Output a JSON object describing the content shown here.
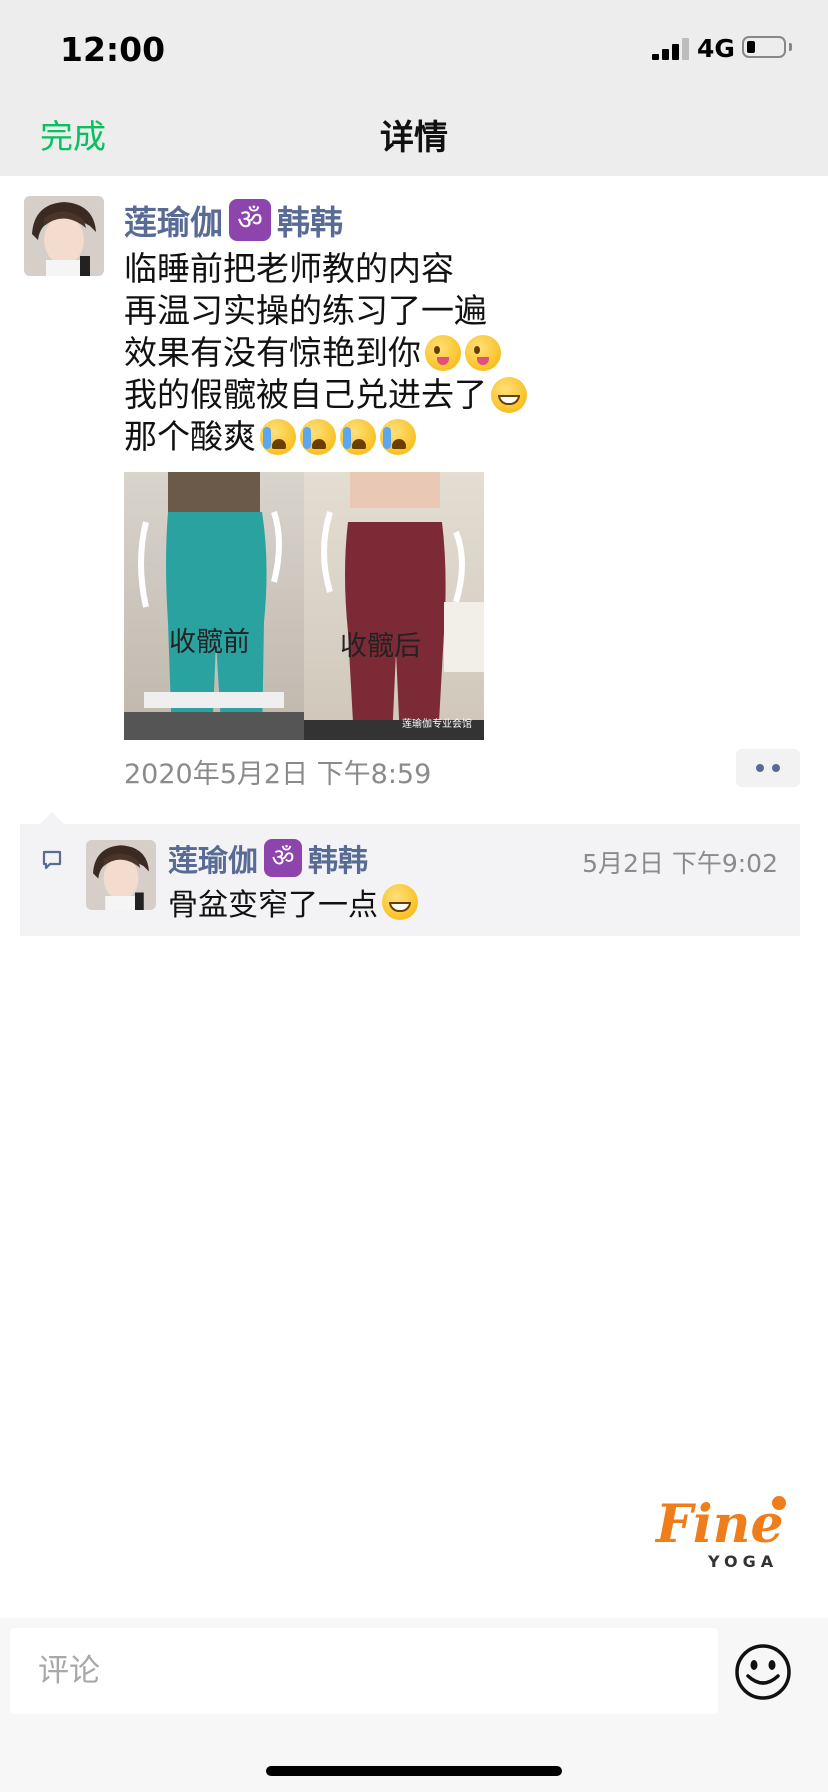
{
  "status_bar": {
    "time": "12:00",
    "network": "4G"
  },
  "nav": {
    "done_label": "完成",
    "title": "详情"
  },
  "post": {
    "author": {
      "name_part1": "莲瑜伽",
      "om_symbol": "ॐ",
      "name_part2": "韩韩"
    },
    "lines": [
      "临睡前把老师教的内容",
      "再温习实操的练习了一遍",
      "效果有没有惊艳到你",
      "我的假髋被自己兑进去了",
      "那个酸爽"
    ],
    "image": {
      "caption_before": "收髋前",
      "caption_after": "收髋后",
      "watermark": "莲瑜伽专业会馆"
    },
    "timestamp": "2020年5月2日 下午8:59"
  },
  "comments": [
    {
      "author": {
        "name_part1": "莲瑜伽",
        "om_symbol": "ॐ",
        "name_part2": "韩韩"
      },
      "time": "5月2日 下午9:02",
      "text": "骨盆变窄了一点"
    }
  ],
  "brand": {
    "script": "Fine",
    "sub": "YOGA"
  },
  "input": {
    "placeholder": "评论"
  },
  "icons": {
    "signal": "signal-icon",
    "battery": "battery-icon",
    "more": "more-dots-icon",
    "comment": "comment-bubble-icon",
    "emoji": "emoji-smiley-icon"
  },
  "colors": {
    "accent_green": "#07c160",
    "name_blue": "#576b95",
    "timestamp_gray": "#8b8b8b",
    "brand_orange": "#ef7d1a"
  }
}
